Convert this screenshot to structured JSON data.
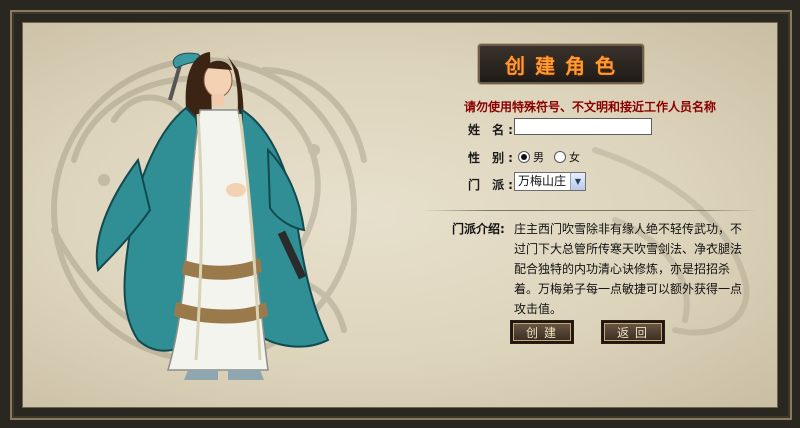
{
  "title": "创建角色",
  "warning": "请勿使用特殊符号、不文明和接近工作人员名称",
  "form": {
    "name_label": "姓 名:",
    "name_value": "",
    "gender_label": "性 别:",
    "gender_options": [
      "男",
      "女"
    ],
    "gender_selected": "男",
    "sect_label": "门 派:",
    "sect_selected": "万梅山庄"
  },
  "intro": {
    "label": "门派介绍:",
    "text": "庄主西门吹雪除非有缘人绝不轻传武功，不过门下大总管所传寒天吹雪剑法、净衣腿法配合独特的内功清心诀修炼，亦是招招杀着。万梅弟子每一点敏捷可以额外获得一点攻击值。"
  },
  "buttons": {
    "create": "创建",
    "back": "返回"
  },
  "colors": {
    "title_text": "#ff9b2f",
    "warning_text": "#8b0000",
    "character_robe": "#2f8f95"
  },
  "icons": {
    "dragon_background": "dragon-pattern",
    "character": "swordsman-character"
  }
}
